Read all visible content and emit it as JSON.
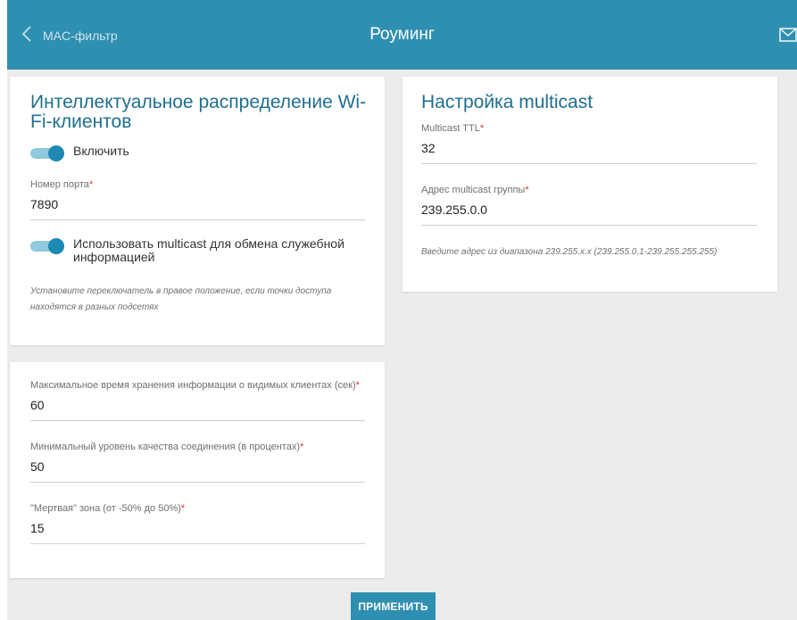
{
  "header": {
    "back_label": "MAC-фильтр",
    "title": "Роуминг"
  },
  "left_card": {
    "title": "Интеллектуальное распределение Wi-Fi-клиентов",
    "enable_toggle": {
      "label": "Включить",
      "state": "on"
    },
    "port": {
      "label": "Номер порта",
      "value": "7890"
    },
    "multicast_toggle": {
      "label": "Использовать multicast для обмена служебной информацией",
      "state": "on"
    },
    "hint": "Установите переключатель в правое положение, если точки доступа находятся в разных подсетях"
  },
  "right_card": {
    "title": "Настройка multicast",
    "ttl": {
      "label": "Multicast TTL",
      "value": "32"
    },
    "group": {
      "label": "Адрес multicast группы",
      "value": "239.255.0.0"
    },
    "hint": "Введите адрес из диапазона 239.255.x.x (239.255.0.1-239.255.255.255)"
  },
  "bottom_card": {
    "max_time": {
      "label": "Максимальное время хранения информации о видимых клиентах (сек)",
      "value": "60"
    },
    "min_quality": {
      "label": "Минимальный уровень качества соединения (в процентах)",
      "value": "50"
    },
    "dead_zone": {
      "label": "\"Мертвая\" зона (от -50% до 50%)",
      "value": "15"
    }
  },
  "required_mark": "*",
  "apply_label": "ПРИМЕНИТЬ",
  "colors": {
    "accent": "#2f8fb0",
    "required": "#e0362b",
    "toggle_knob": "#1e8ab3"
  },
  "icons": {
    "back": "chevron-left-icon",
    "mail": "envelope-icon"
  }
}
